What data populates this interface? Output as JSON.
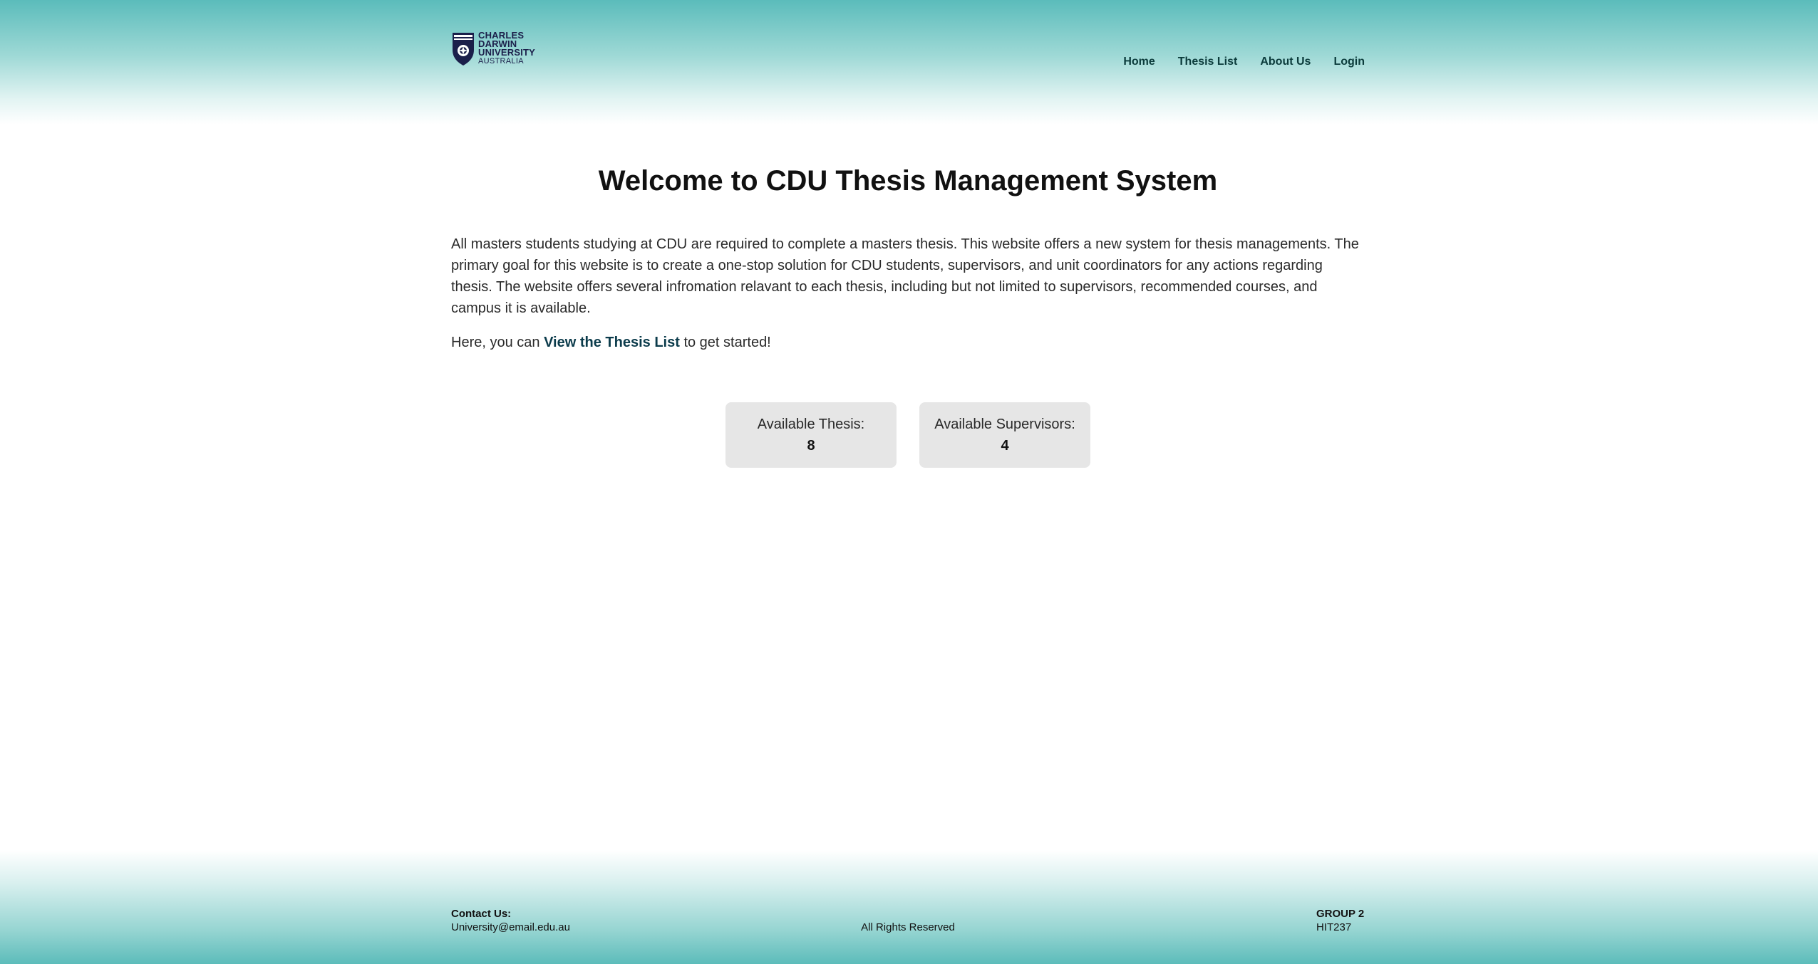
{
  "logo": {
    "line1": "CHARLES",
    "line2": "DARWIN",
    "line3": "UNIVERSITY",
    "line4": "AUSTRALIA"
  },
  "nav": {
    "items": [
      {
        "label": "Home"
      },
      {
        "label": "Thesis List"
      },
      {
        "label": "About Us"
      },
      {
        "label": "Login"
      }
    ]
  },
  "main": {
    "title": "Welcome to CDU Thesis Management System",
    "intro": "All masters students studying at CDU are required to complete a masters thesis. This website offers a new system for thesis managements. The primary goal for this website is to create a one-stop solution for CDU students, supervisors, and unit coordinators for any actions regarding thesis. The website offers several infromation relavant to each thesis, including but not limited to supervisors, recommended courses, and campus it is available.",
    "cta_prefix": "Here, you can ",
    "cta_link": "View the Thesis List",
    "cta_suffix": " to get started!"
  },
  "stats": [
    {
      "label": "Available Thesis:",
      "value": "8"
    },
    {
      "label": "Available Supervisors:",
      "value": "4"
    }
  ],
  "footer": {
    "contact_heading": "Contact Us:",
    "contact_email": "University@email.edu.au",
    "rights": "All Rights Reserved",
    "group": "GROUP 2",
    "unit": "HIT237"
  },
  "colors": {
    "header_teal": "#5bbcbb",
    "nav_text": "#0b3b3b",
    "card_bg": "#e6e6e6",
    "logo_navy": "#1b1f4a"
  }
}
